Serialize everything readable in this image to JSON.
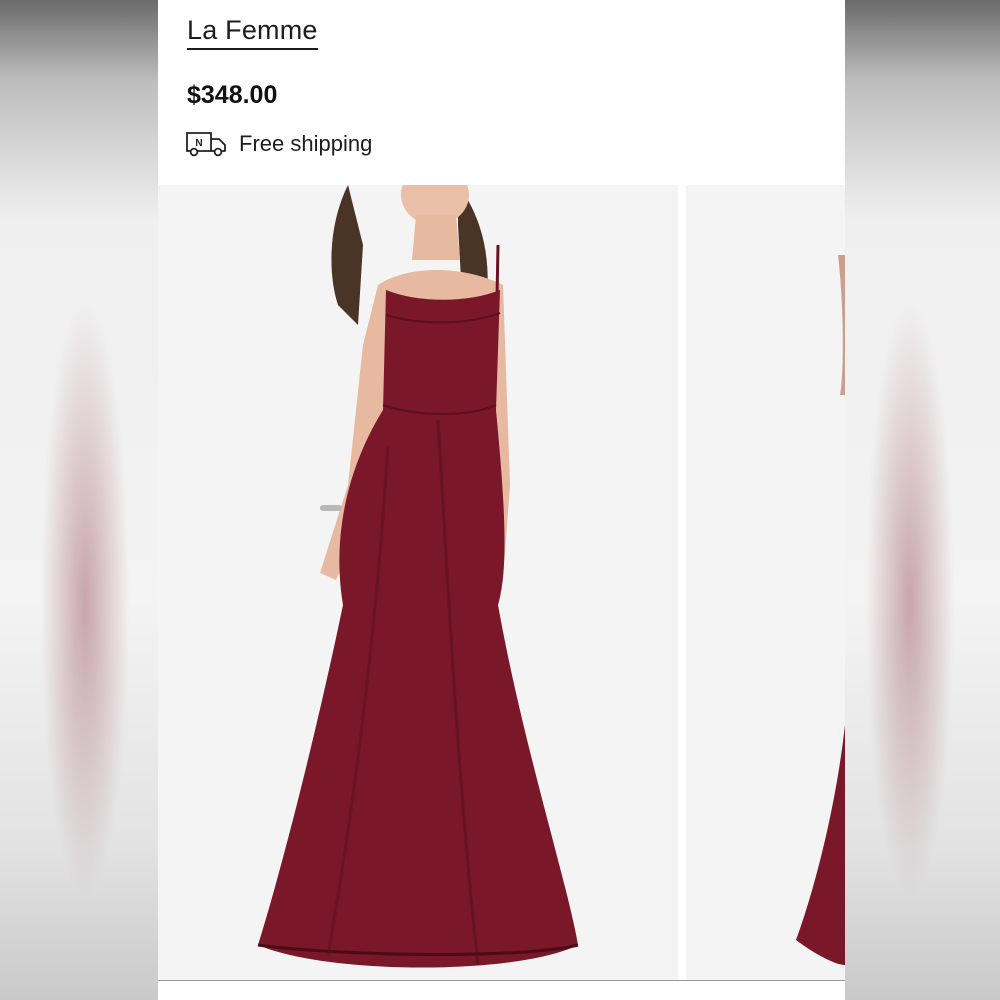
{
  "product": {
    "brand": "La Femme",
    "price": "$348.00",
    "shipping": {
      "icon": "delivery-truck-icon",
      "truck_badge": "N",
      "label": "Free shipping"
    }
  },
  "gallery": {
    "images": [
      {
        "alt": "Burgundy satin mermaid gown, front view"
      },
      {
        "alt": "Burgundy satin mermaid gown, side view"
      }
    ]
  },
  "colors": {
    "dress": "#7a1728",
    "background": "#f4f4f4",
    "text": "#1d1d1d"
  }
}
